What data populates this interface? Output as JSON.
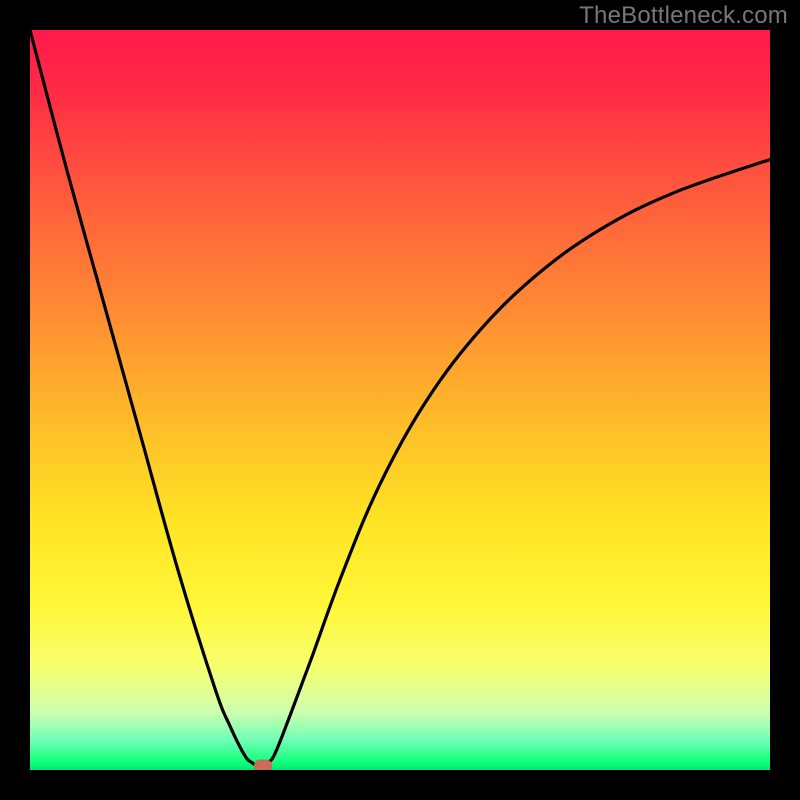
{
  "watermark": "TheBottleneck.com",
  "chart_data": {
    "type": "line",
    "title": "",
    "xlabel": "",
    "ylabel": "",
    "xlim": [
      0,
      1
    ],
    "ylim": [
      0,
      1
    ],
    "grid": false,
    "legend": false,
    "x": [
      0.0,
      0.05,
      0.1,
      0.15,
      0.2,
      0.25,
      0.27,
      0.29,
      0.3,
      0.31,
      0.32,
      0.33,
      0.35,
      0.38,
      0.42,
      0.47,
      0.53,
      0.6,
      0.68,
      0.77,
      0.87,
      1.0
    ],
    "y": [
      1.0,
      0.81,
      0.63,
      0.45,
      0.27,
      0.11,
      0.06,
      0.02,
      0.01,
      0.005,
      0.01,
      0.02,
      0.07,
      0.15,
      0.26,
      0.38,
      0.49,
      0.585,
      0.665,
      0.73,
      0.78,
      0.825
    ],
    "marker": {
      "x": 0.315,
      "y": 0.005
    },
    "background_gradient": {
      "stops": [
        {
          "pos": 0.0,
          "color": "#ff1a4b"
        },
        {
          "pos": 0.5,
          "color": "#ffcc22"
        },
        {
          "pos": 0.8,
          "color": "#fff73a"
        },
        {
          "pos": 1.0,
          "color": "#00e673"
        }
      ]
    }
  }
}
